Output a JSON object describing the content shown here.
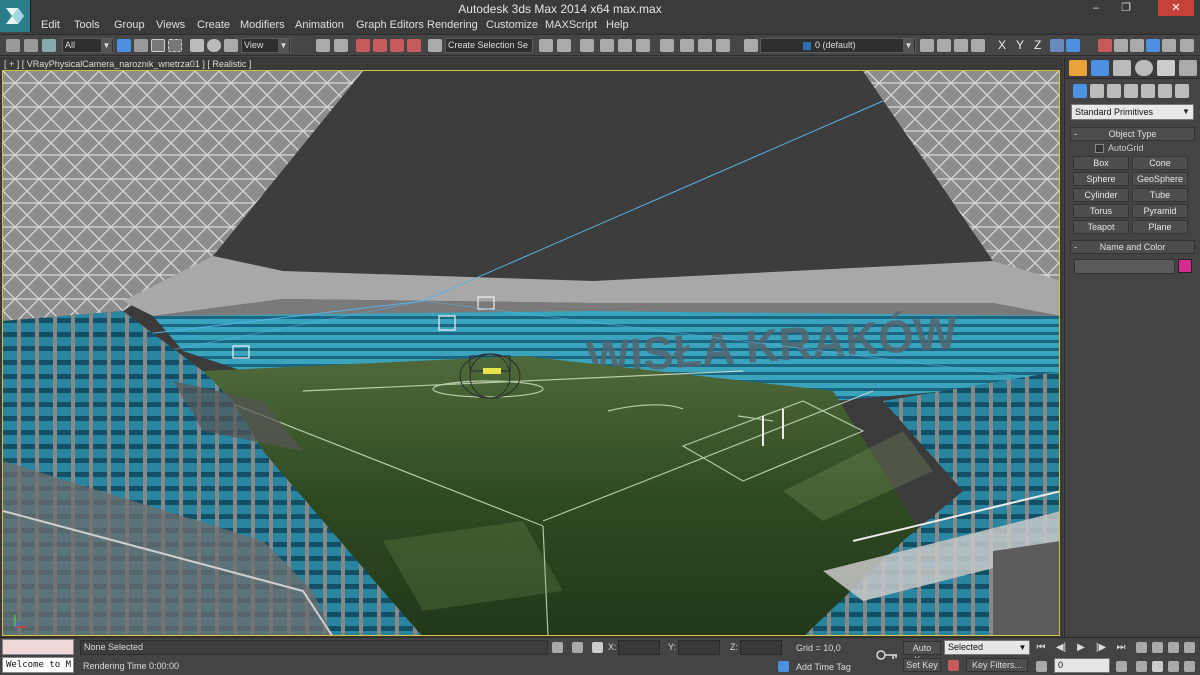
{
  "window": {
    "title": "Autodesk 3ds Max  2014 x64       max.max",
    "minimize_glyph": "–",
    "restore_glyph": "❐",
    "close_glyph": "✕",
    "logo_icon": "3ds-max-logo-icon"
  },
  "menu": {
    "items": [
      "Edit",
      "Tools",
      "Group",
      "Views",
      "Create",
      "Modifiers",
      "Animation",
      "Graph Editors",
      "Rendering",
      "Customize",
      "MAXScript",
      "Help"
    ]
  },
  "toolbar": {
    "selection_filter": "All",
    "reference_coord": "View",
    "named_selection_placeholder": "Create Selection Se",
    "layer": "0 (default)",
    "axis_x": "X",
    "axis_y": "Y",
    "axis_z": "Z"
  },
  "viewport": {
    "label": "[ + ] [ VRayPhysicalCamera_naroznik_wnetrza01 ] [ Realistic ]",
    "active_border_color": "#d8c03a",
    "stand_lettering": "WISŁA KRAKÓW"
  },
  "command_panel": {
    "category": "Standard Primitives",
    "object_type_title": "Object Type",
    "autogrid_label": "AutoGrid",
    "primitives": [
      "Box",
      "Cone",
      "Sphere",
      "GeoSphere",
      "Cylinder",
      "Tube",
      "Torus",
      "Pyramid",
      "Teapot",
      "Plane"
    ],
    "name_color_title": "Name and Color",
    "object_color": "#d42d8f",
    "rollout_sign": "-"
  },
  "status": {
    "maxscript_text": "Welcome to M",
    "selection_text": "None Selected",
    "render_time_text": "Rendering Time  0:00:00",
    "x_label": "X:",
    "y_label": "Y:",
    "z_label": "Z:",
    "grid_text": "Grid = 10,0",
    "add_time_tag": "Add Time Tag",
    "auto_key": "Auto Key",
    "set_key": "Set Key",
    "key_mode": "Selected",
    "key_filters": "Key Filters...",
    "frame": "0"
  }
}
